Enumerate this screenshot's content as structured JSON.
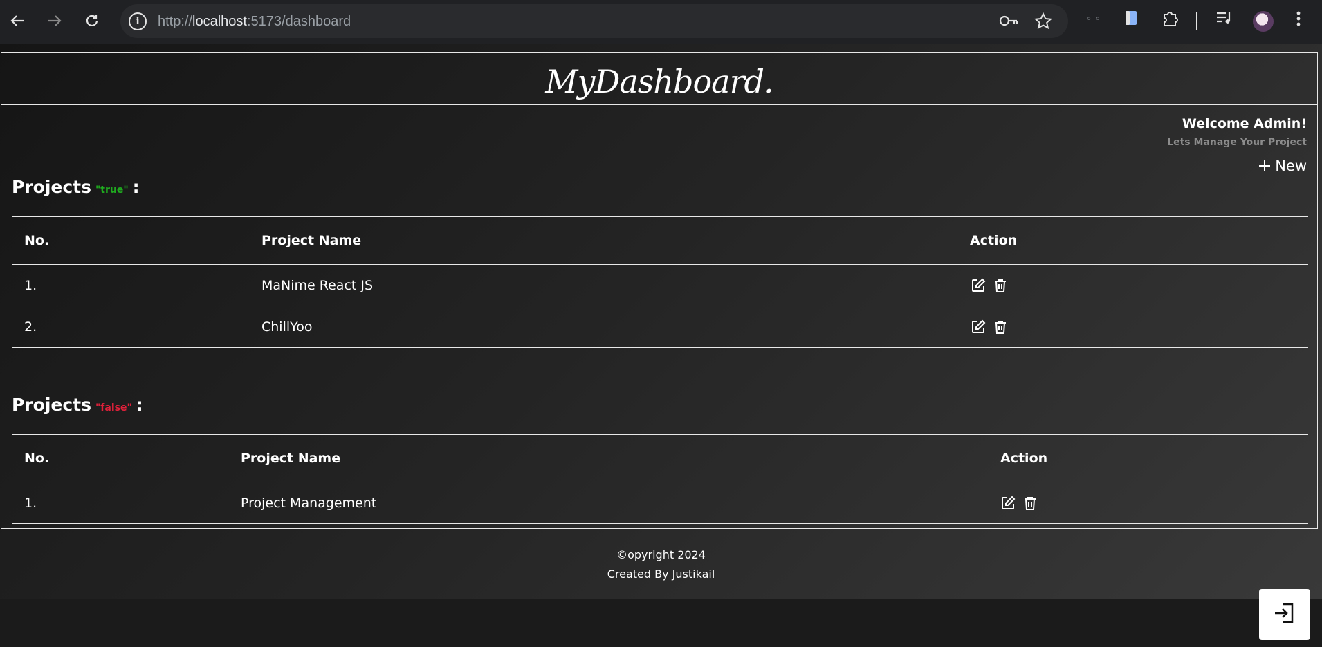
{
  "browser": {
    "url_scheme": "http://",
    "url_host": "localhost",
    "url_path": ":5173/dashboard"
  },
  "header": {
    "logo": "MyDashboard."
  },
  "welcome": {
    "title": "Welcome Admin!",
    "subtitle": "Lets Manage Your Project"
  },
  "new_button": {
    "label": "New"
  },
  "sections": [
    {
      "title": "Projects",
      "badge": "\"true\"",
      "colon": ":",
      "columns": [
        "No.",
        "Project Name",
        "Action"
      ],
      "rows": [
        {
          "no": "1.",
          "name": "MaNime React JS"
        },
        {
          "no": "2.",
          "name": "ChillYoo"
        }
      ]
    },
    {
      "title": "Projects",
      "badge": "\"false\"",
      "colon": ":",
      "columns": [
        "No.",
        "Project Name",
        "Action"
      ],
      "rows": [
        {
          "no": "1.",
          "name": "Project Management"
        }
      ]
    }
  ],
  "footer": {
    "copyright": "©opyright 2024",
    "created_by": "Created By",
    "author": "Justikail"
  },
  "colors": {
    "true_badge": "#1faa1f",
    "false_badge": "#e0203a"
  },
  "icons": [
    "back-icon",
    "forward-icon",
    "reload-icon",
    "site-info-icon",
    "key-icon",
    "star-icon",
    "extensions-icon",
    "media-icon",
    "menu-icon",
    "edit-icon",
    "trash-icon",
    "logout-icon"
  ]
}
